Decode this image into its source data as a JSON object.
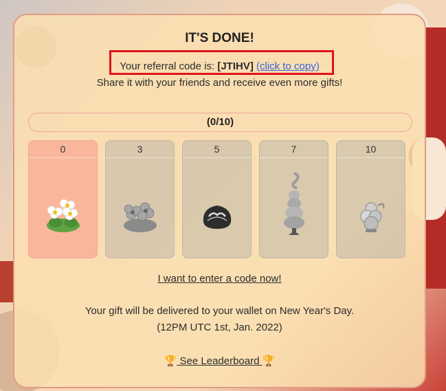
{
  "heading": "IT'S DONE!",
  "referral": {
    "prefix": "Your referral code is: ",
    "code": "[JTIHV]",
    "copy_label": "(click to copy)"
  },
  "share_text": "Share it with your friends and receive even more gifts!",
  "progress": {
    "label": "(0/10)",
    "current": 0,
    "total": 10
  },
  "rewards": [
    {
      "count": "0",
      "icon": "white-flowers-icon",
      "unlocked": true
    },
    {
      "count": "3",
      "icon": "gray-flowers-icon",
      "unlocked": false
    },
    {
      "count": "5",
      "icon": "chocolate-truffle-icon",
      "unlocked": false
    },
    {
      "count": "7",
      "icon": "swirl-tree-icon",
      "unlocked": false
    },
    {
      "count": "10",
      "icon": "sheep-figure-icon",
      "unlocked": false
    }
  ],
  "enter_code_label": "I want to enter a code now!",
  "delivery_text": "Your gift will be delivered to your wallet on New Year's Day.",
  "delivery_time": "(12PM UTC 1st, Jan. 2022)",
  "leaderboard_label": " See Leaderboard ",
  "colors": {
    "accent_red": "#e0141b",
    "link_blue": "#3562d6",
    "panel_border": "#e29a86"
  }
}
